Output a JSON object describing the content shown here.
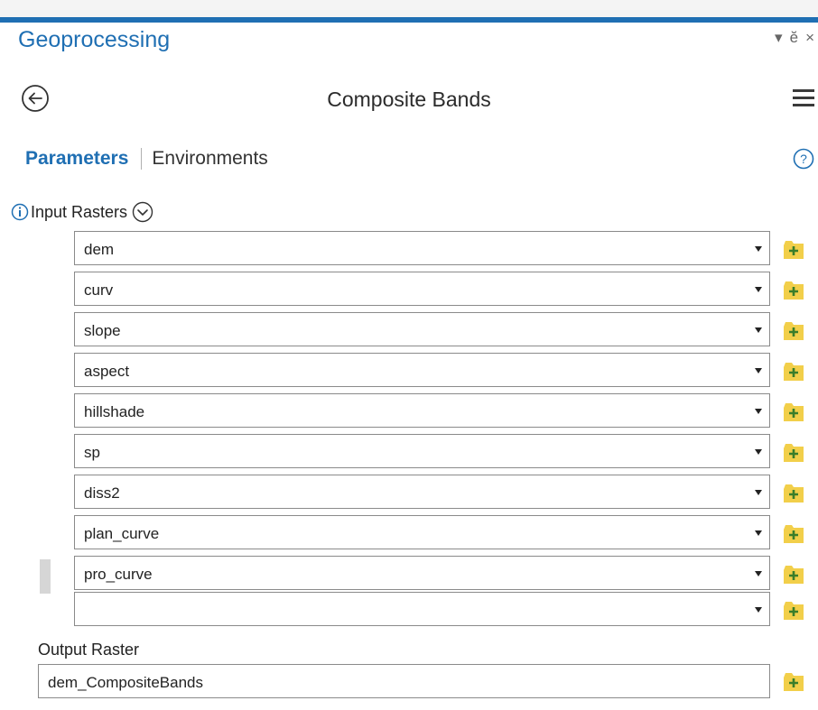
{
  "colors": {
    "accent": "#1f6fb3",
    "folder": "#f2cf4a",
    "folder_plus": "#3a7d2a"
  },
  "pane": {
    "title": "Geoprocessing",
    "pin_glyph": "ѥ",
    "close_glyph": "×",
    "dropdown_glyph": "▾"
  },
  "tool": {
    "title": "Composite Bands"
  },
  "tabs": {
    "parameters": "Parameters",
    "environments": "Environments"
  },
  "input": {
    "label": "Input Rasters",
    "rasters": [
      "dem",
      "curv",
      "slope",
      "aspect",
      "hillshade",
      "sp",
      "diss2",
      "plan_curve",
      "pro_curve",
      ""
    ]
  },
  "output": {
    "label": "Output Raster",
    "value": "dem_CompositeBands"
  }
}
